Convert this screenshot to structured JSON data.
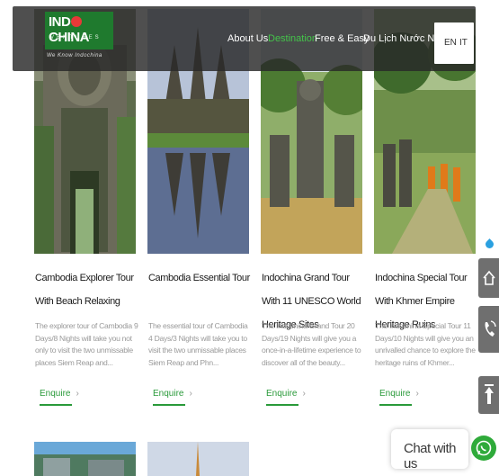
{
  "header": {
    "logo_main_left": "IND",
    "logo_main_right": "CHINA",
    "logo_sub": "VENTURES",
    "tagline": "We Know Indochina",
    "nav": [
      {
        "label": "About Us",
        "active": false
      },
      {
        "label": "Destination",
        "active": true
      },
      {
        "label": "Free & Easy",
        "active": false
      },
      {
        "label": "Du Lịch Nước Ngoài",
        "active": false
      }
    ],
    "lang": {
      "en": "EN",
      "it": "IT"
    }
  },
  "tours": [
    {
      "title": "Cambodia Explorer Tour With Beach Relaxing",
      "desc": "The explorer tour of Cambodia 9 Days/8 Nights will take you not only to visit the two unmissable places Siem Reap and...",
      "enquire": "Enquire"
    },
    {
      "title": "Cambodia Essential Tour",
      "desc": "The essential tour of Cambodia 4 Days/3 Nights will take you to visit the two unmissable places Siem Reap and Phn...",
      "enquire": "Enquire"
    },
    {
      "title": "Indochina Grand Tour With 11 UNESCO World Heritage Sites",
      "desc": "The Indochina Grand Tour 20 Days/19 Nights will give you a once-in-a-lifetime experience to discover all of the beauty...",
      "enquire": "Enquire"
    },
    {
      "title": "Indochina Special Tour With Khmer Empire Heritage Ruins",
      "desc": "The Indochina Special Tour 11 Days/10 Nights will give you an unrivalled chance to explore the heritage ruins of Khmer...",
      "enquire": "Enquire"
    }
  ],
  "chat": {
    "label": "Chat with us"
  },
  "colors": {
    "accent": "#2a9a3a",
    "nav_active": "#44c44a",
    "header_bg": "#282828"
  },
  "icons": {
    "side_top": "home-icon",
    "side_middle": "phone-ring-icon",
    "side_bottom": "scroll-top-icon",
    "chat": "whatsapp-icon"
  }
}
